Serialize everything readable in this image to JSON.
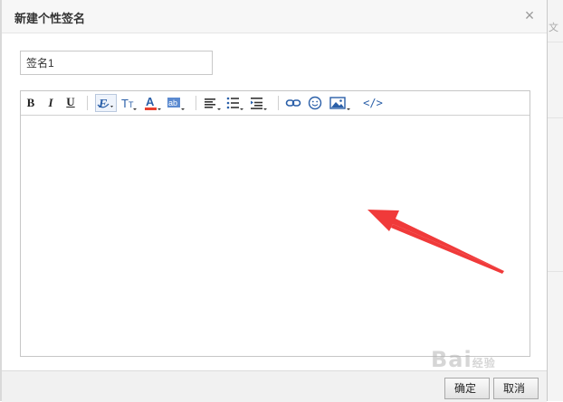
{
  "dialog": {
    "title": "新建个性签名",
    "close_symbol": "×",
    "signature_name_value": "签名1"
  },
  "toolbar": {
    "bold": "B",
    "italic": "I",
    "underline": "U",
    "code": "</>"
  },
  "footer": {
    "confirm_label": "确定",
    "cancel_label": "取消"
  },
  "background": {
    "partial_text": "文"
  },
  "watermark": {
    "text": "Bai",
    "suffix": "经验"
  },
  "colors": {
    "accent_arrow": "#f03a3a",
    "text_color_swatch": "#e8402e",
    "icon_blue": "#2a5fa8"
  }
}
